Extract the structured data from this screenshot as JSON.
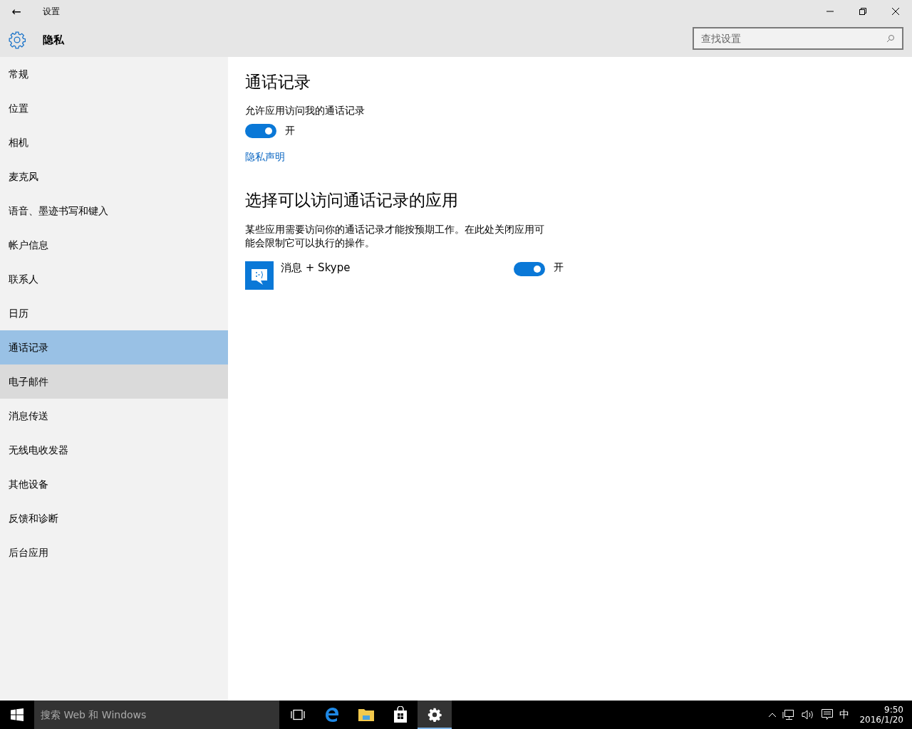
{
  "window": {
    "title": "设置",
    "back": "←"
  },
  "header": {
    "title": "隐私",
    "search": {
      "placeholder": "查找设置"
    }
  },
  "sidebar": {
    "items": [
      {
        "label": "常规",
        "selected": false,
        "hovered": false
      },
      {
        "label": "位置",
        "selected": false,
        "hovered": false
      },
      {
        "label": "相机",
        "selected": false,
        "hovered": false
      },
      {
        "label": "麦克风",
        "selected": false,
        "hovered": false
      },
      {
        "label": "语音、墨迹书写和键入",
        "selected": false,
        "hovered": false
      },
      {
        "label": "帐户信息",
        "selected": false,
        "hovered": false
      },
      {
        "label": "联系人",
        "selected": false,
        "hovered": false
      },
      {
        "label": "日历",
        "selected": false,
        "hovered": false
      },
      {
        "label": "通话记录",
        "selected": true,
        "hovered": false
      },
      {
        "label": "电子邮件",
        "selected": false,
        "hovered": true
      },
      {
        "label": "消息传送",
        "selected": false,
        "hovered": false
      },
      {
        "label": "无线电收发器",
        "selected": false,
        "hovered": false
      },
      {
        "label": "其他设备",
        "selected": false,
        "hovered": false
      },
      {
        "label": "反馈和诊断",
        "selected": false,
        "hovered": false
      },
      {
        "label": "后台应用",
        "selected": false,
        "hovered": false
      }
    ]
  },
  "content": {
    "title": "通话记录",
    "toggle_label": "允许应用访问我的通话记录",
    "toggle": {
      "on": true,
      "label": "开"
    },
    "link": "隐私声明",
    "section_title": "选择可以访问通话记录的应用",
    "description": "某些应用需要访问你的通话记录才能按预期工作。在此处关闭应用可能会限制它可以执行的操作。",
    "apps": [
      {
        "name": "消息 + Skype",
        "on": true,
        "label": "开"
      }
    ]
  },
  "taskbar": {
    "search": {
      "placeholder": "搜索 Web 和 Windows"
    },
    "ime": "中",
    "time": "9:50",
    "date": "2016/1/20"
  }
}
